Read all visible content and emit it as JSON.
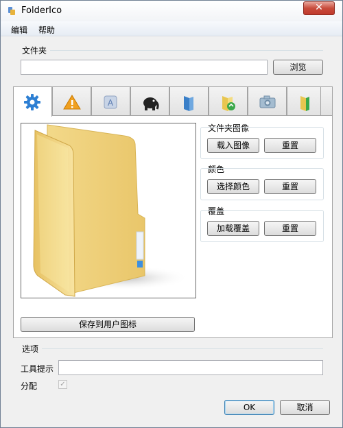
{
  "window": {
    "title": "FolderIco",
    "close_label": "✕"
  },
  "menu": {
    "items": [
      "编辑",
      "帮助"
    ]
  },
  "folder_group": {
    "label": "文件夹",
    "input_value": "",
    "browse_label": "浏览"
  },
  "tabs": [
    {
      "name": "gear-icon"
    },
    {
      "name": "warning-icon"
    },
    {
      "name": "app-store-icon"
    },
    {
      "name": "elephant-icon"
    },
    {
      "name": "blue-folder-icon"
    },
    {
      "name": "recycle-folder-icon"
    },
    {
      "name": "camera-icon"
    },
    {
      "name": "yellow-folder-icon"
    }
  ],
  "side": {
    "image": {
      "label": "文件夹图像",
      "load_label": "载入图像",
      "reset_label": "重置"
    },
    "color": {
      "label": "颜色",
      "select_label": "选择颜色",
      "reset_label": "重置"
    },
    "overlay": {
      "label": "覆盖",
      "load_label": "加载覆盖",
      "reset_label": "重置"
    }
  },
  "save_user_icon_label": "保存到用户图标",
  "options": {
    "label": "选项",
    "tooltip_label": "工具提示",
    "tooltip_value": "",
    "assign_label": "分配",
    "assign_checked": true
  },
  "footer": {
    "ok_label": "OK",
    "cancel_label": "取消"
  }
}
